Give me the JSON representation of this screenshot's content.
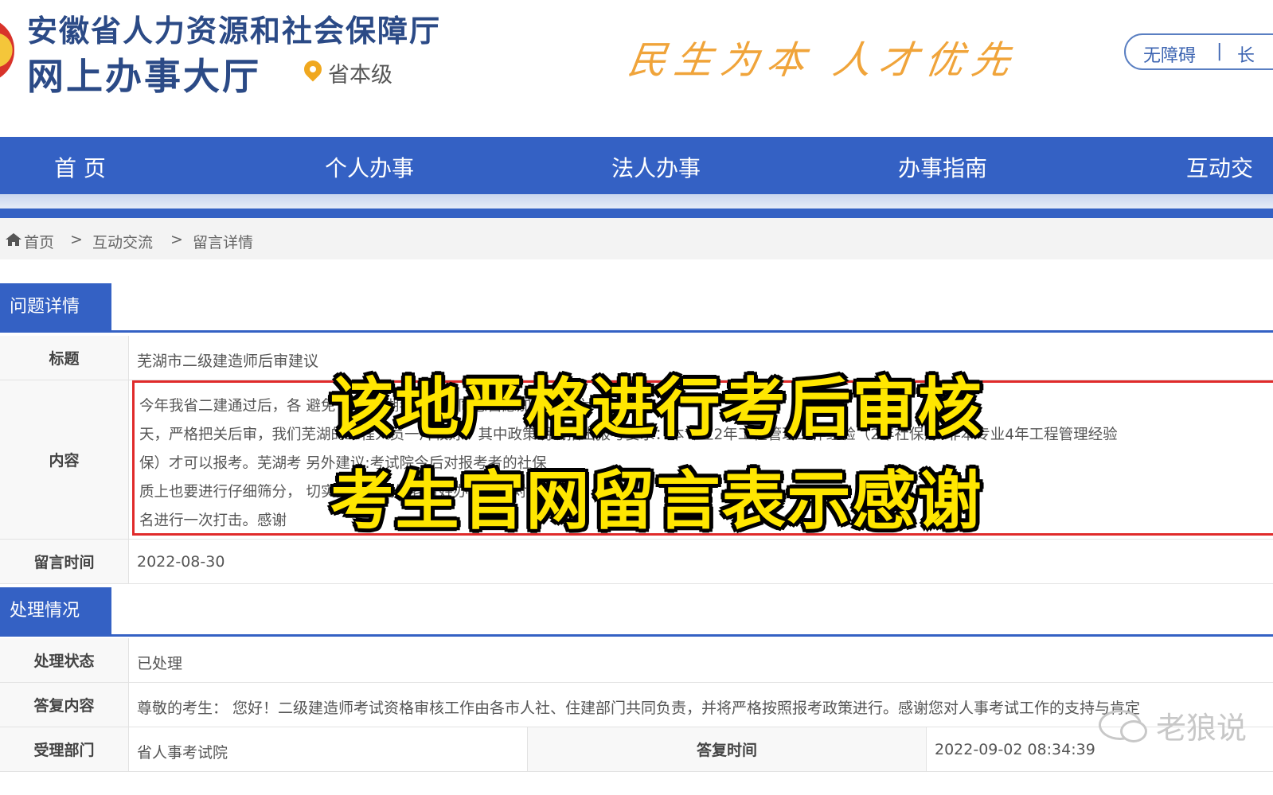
{
  "header": {
    "title_line1": "安徽省人力资源和社会保障厅",
    "title_line2": "网上办事大厅",
    "level": "省本级",
    "slogan": "民生为本  人才优先",
    "access_label": "无障碍",
    "access_separator": "|",
    "access_label2": "长"
  },
  "nav": {
    "items": [
      "首 页",
      "个人办事",
      "法人办事",
      "办事指南",
      "互动交"
    ]
  },
  "breadcrumb": {
    "items": [
      "首页",
      "互动交流",
      "留言详情"
    ],
    "separator": ">"
  },
  "question_section": {
    "tab_label": "问题详情",
    "title_label": "标题",
    "title_value": "芜湖市二级建造师后审建议",
    "content_label": "内容",
    "content_lines": [
      "今年我省二建通过后，各                    避免了                                                               徽芜湖考试院的同志自愿加班星期六",
      "天，严格把关后审，我们芜湖的工程人员一片较好。其中政策明确指出报考要求：本专业2年工程管理工作经验（2年社保），非本专业4年工程管理经验",
      "保）才可以报考。芜湖考                                                              另外建议:考试院今后对报考者的社保",
      "质上也要进行仔细筛分，                                                                    切实实的为我们老百姓办事了，对芜",
      "名进行一次打击。感谢"
    ],
    "time_label": "留言时间",
    "time_value": "2022-08-30"
  },
  "handling_section": {
    "tab_label": "处理情况",
    "status_label": "处理状态",
    "status_value": "已处理",
    "reply_label": "答复内容",
    "reply_value": "尊敬的考生： 您好！二级建造师考试资格审核工作由各市人社、住建部门共同负责，并将严格按照报考政策进行。感谢您对人事考试工作的支持与肯定",
    "dept_label": "受理部门",
    "dept_value": "省人事考试院",
    "reply_time_label": "答复时间",
    "reply_time_value": "2022-09-02 08:34:39"
  },
  "overlay": {
    "caption_line1": "该地严格进行考后审核",
    "caption_line2": "考生官网留言表示感谢"
  },
  "watermark": {
    "text": "老狼说"
  },
  "colors": {
    "brand_blue": "#3461c4",
    "title_blue": "#2b4a86",
    "slogan_orange": "#f0a43a",
    "highlight_red": "#e02a2a",
    "caption_yellow": "#ffe600"
  }
}
